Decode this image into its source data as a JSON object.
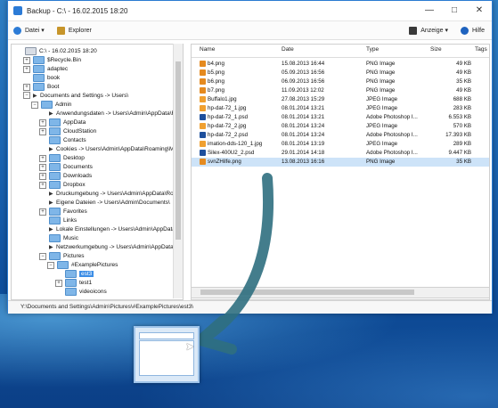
{
  "window": {
    "title": "Backup - C:\\ - 16.02.2015 18:20",
    "minimize_glyph": "—",
    "maximize_glyph": "□",
    "close_glyph": "✕"
  },
  "toolbar": {
    "datei": "Datei ▾",
    "explorer": "Explorer",
    "anzeige": "Anzeige ▾",
    "hilfe": "Hilfe"
  },
  "tree": [
    {
      "label": "C:\\ - 16.02.2015 18:20",
      "indent": 0,
      "marker": "",
      "icon": "pc"
    },
    {
      "label": "$Recycle.Bin",
      "indent": 1,
      "marker": "+",
      "icon": "folder"
    },
    {
      "label": "adaptec",
      "indent": 1,
      "marker": "+",
      "icon": "folder"
    },
    {
      "label": "book",
      "indent": 1,
      "marker": "",
      "icon": "folder"
    },
    {
      "label": "Boot",
      "indent": 1,
      "marker": "+",
      "icon": "folder"
    },
    {
      "label": "Documents and Settings -> Users\\",
      "indent": 1,
      "marker": "−",
      "icon": "arrow"
    },
    {
      "label": "Admin",
      "indent": 2,
      "marker": "−",
      "icon": "folder"
    },
    {
      "label": "Anwendungsdaten -> Users\\Admin\\AppData\\R",
      "indent": 3,
      "marker": "",
      "icon": "arrow"
    },
    {
      "label": "AppData",
      "indent": 3,
      "marker": "+",
      "icon": "folder"
    },
    {
      "label": "CloudStation",
      "indent": 3,
      "marker": "+",
      "icon": "folder"
    },
    {
      "label": "Contacts",
      "indent": 3,
      "marker": "",
      "icon": "folder"
    },
    {
      "label": "Cookies -> Users\\Admin\\AppData\\Roaming\\Mi",
      "indent": 3,
      "marker": "",
      "icon": "arrow"
    },
    {
      "label": "Desktop",
      "indent": 3,
      "marker": "+",
      "icon": "folder"
    },
    {
      "label": "Documents",
      "indent": 3,
      "marker": "+",
      "icon": "folder"
    },
    {
      "label": "Downloads",
      "indent": 3,
      "marker": "+",
      "icon": "folder"
    },
    {
      "label": "Dropbox",
      "indent": 3,
      "marker": "+",
      "icon": "folder"
    },
    {
      "label": "Druckumgebung -> Users\\Admin\\AppData\\Roa",
      "indent": 3,
      "marker": "",
      "icon": "arrow"
    },
    {
      "label": "Eigene Dateien -> Users\\Admin\\Documents\\",
      "indent": 3,
      "marker": "",
      "icon": "arrow"
    },
    {
      "label": "Favorites",
      "indent": 3,
      "marker": "+",
      "icon": "folder"
    },
    {
      "label": "Links",
      "indent": 3,
      "marker": "",
      "icon": "folder"
    },
    {
      "label": "Lokale Einstellungen -> Users\\Admin\\AppData\\",
      "indent": 3,
      "marker": "",
      "icon": "arrow"
    },
    {
      "label": "Music",
      "indent": 3,
      "marker": "",
      "icon": "folder"
    },
    {
      "label": "Netzwerkumgebung -> Users\\Admin\\AppData\\R",
      "indent": 3,
      "marker": "",
      "icon": "arrow"
    },
    {
      "label": "Pictures",
      "indent": 3,
      "marker": "−",
      "icon": "folder"
    },
    {
      "label": "#ExamplePictures",
      "indent": 4,
      "marker": "−",
      "icon": "folder"
    },
    {
      "label": "est3",
      "indent": 5,
      "marker": "",
      "icon": "folder",
      "selected": true
    },
    {
      "label": "test1",
      "indent": 5,
      "marker": "+",
      "icon": "folder"
    },
    {
      "label": "videoicons",
      "indent": 5,
      "marker": "",
      "icon": "folder"
    }
  ],
  "files": {
    "headers": [
      "Name",
      "Date",
      "Type",
      "Size",
      "Tags"
    ],
    "rows": [
      {
        "name": "b4.png",
        "date": "15.08.2013 16:44",
        "type": "PNG Image",
        "size": "49 KB",
        "icon": "png"
      },
      {
        "name": "b5.png",
        "date": "05.09.2013 16:56",
        "type": "PNG Image",
        "size": "49 KB",
        "icon": "png"
      },
      {
        "name": "b6.png",
        "date": "06.09.2013 16:56",
        "type": "PNG Image",
        "size": "35 KB",
        "icon": "png"
      },
      {
        "name": "b7.png",
        "date": "11.09.2013 12:02",
        "type": "PNG Image",
        "size": "49 KB",
        "icon": "png"
      },
      {
        "name": "Buffalo1.jpg",
        "date": "27.08.2013 15:29",
        "type": "JPEG Image",
        "size": "688 KB",
        "icon": "jpg"
      },
      {
        "name": "hp-dat-72_1.jpg",
        "date": "08.01.2014 13:21",
        "type": "JPEG Image",
        "size": "283 KB",
        "icon": "jpg"
      },
      {
        "name": "hp-dat-72_1.psd",
        "date": "08.01.2014 13:21",
        "type": "Adobe Photoshop I...",
        "size": "6.553 KB",
        "icon": "psd"
      },
      {
        "name": "hp-dat-72_2.jpg",
        "date": "08.01.2014 13:24",
        "type": "JPEG Image",
        "size": "570 KB",
        "icon": "jpg"
      },
      {
        "name": "hp-dat-72_2.psd",
        "date": "08.01.2014 13:24",
        "type": "Adobe Photoshop I...",
        "size": "17.393 KB",
        "icon": "psd"
      },
      {
        "name": "imation-dds-120_1.jpg",
        "date": "08.01.2014 13:19",
        "type": "JPEG Image",
        "size": "289 KB",
        "icon": "jpg"
      },
      {
        "name": "Silex-400U2_2.psd",
        "date": "29.01.2014 14:18",
        "type": "Adobe Photoshop I...",
        "size": "9.447 KB",
        "icon": "psd"
      },
      {
        "name": "svnZHilfe.png",
        "date": "13.08.2013 16:16",
        "type": "PNG Image",
        "size": "35 KB",
        "icon": "png",
        "selected": true
      }
    ]
  },
  "status": {
    "path": "Y:\\Documents and Settings\\Admin\\Pictures\\#ExamplePictures\\est3\\"
  },
  "colors": {
    "accent": "#2c7bd6",
    "png": "#e58a1f",
    "jpg": "#f0a030",
    "psd": "#1e4f9c"
  }
}
